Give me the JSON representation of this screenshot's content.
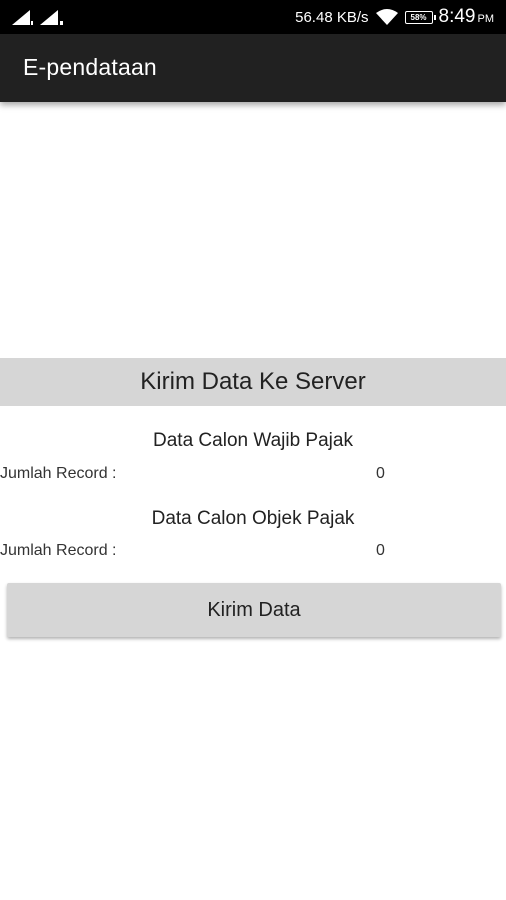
{
  "status_bar": {
    "net_speed": "56.48 KB/s",
    "battery": "58%",
    "time": "8:49",
    "ampm": "PM"
  },
  "app_bar": {
    "title": "E-pendataan"
  },
  "main": {
    "header": "Kirim Data Ke Server",
    "wajib_pajak": {
      "title": "Data Calon Wajib Pajak",
      "record_label": "Jumlah Record :",
      "record_value": "0"
    },
    "objek_pajak": {
      "title": "Data Calon Objek Pajak",
      "record_label": "Jumlah Record :",
      "record_value": "0"
    },
    "send_button": "Kirim Data"
  }
}
